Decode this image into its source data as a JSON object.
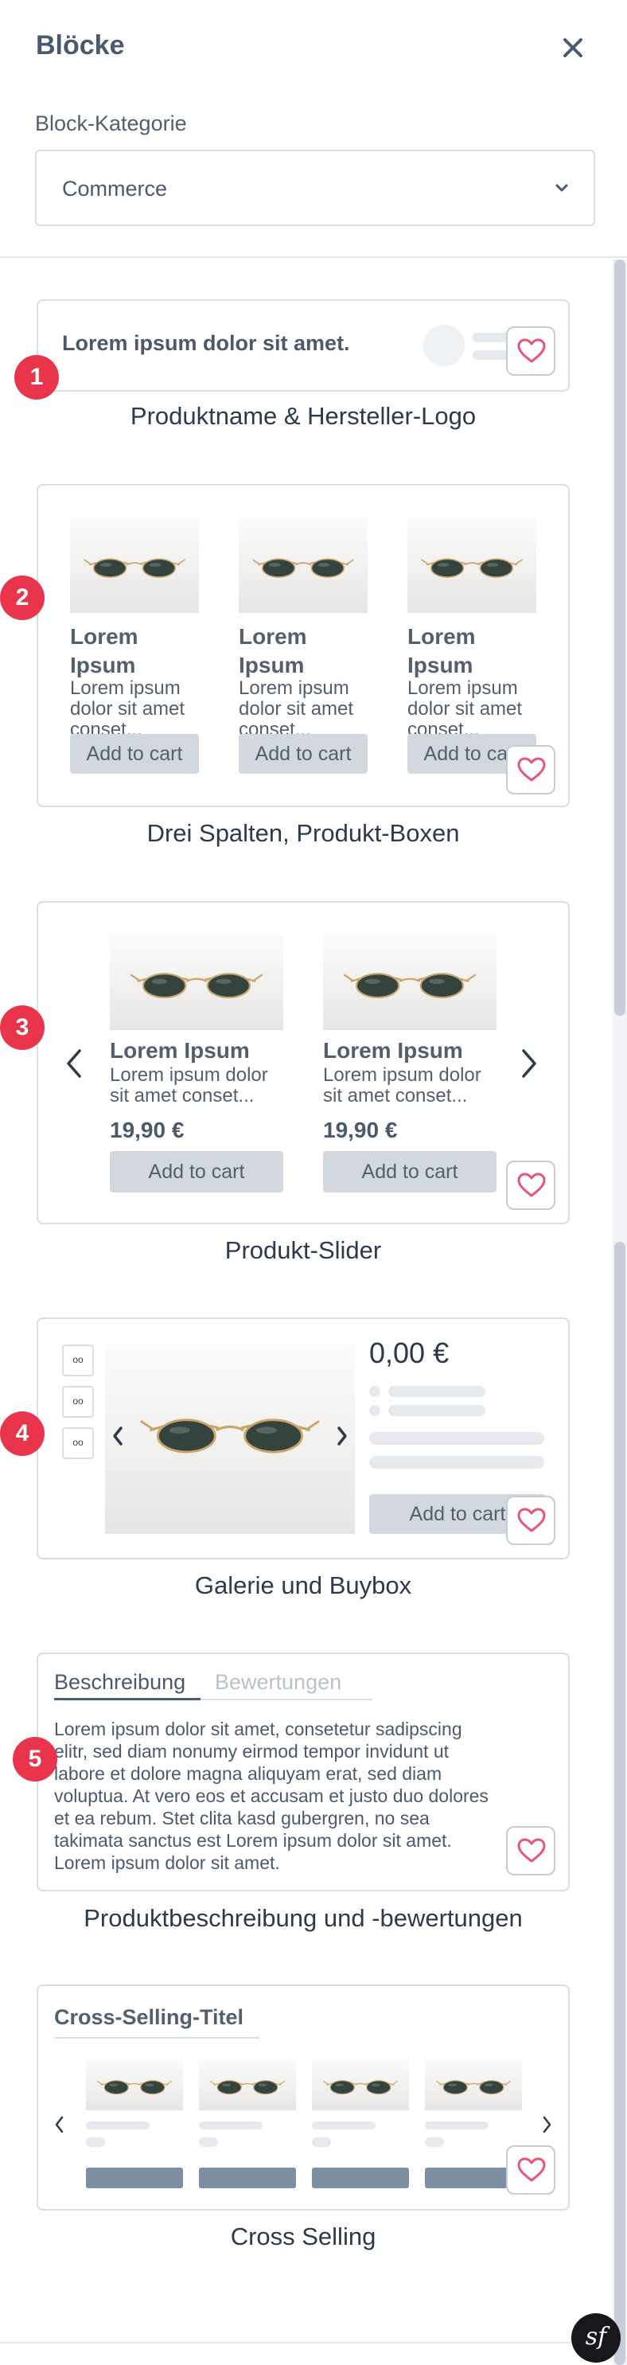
{
  "header": {
    "title": "Blöcke",
    "close_icon": "close-icon"
  },
  "category": {
    "label": "Block-Kategorie",
    "value": "Commerce"
  },
  "blocks": [
    {
      "number": "1",
      "caption": "Produktname & Hersteller-Logo",
      "preview_text": "Lorem ipsum dolor sit amet."
    },
    {
      "number": "2",
      "caption": "Drei Spalten, Produkt-Boxen",
      "product_title_line1": "Lorem",
      "product_title_line2": "Ipsum",
      "product_desc_line1": "Lorem ipsum",
      "product_desc_line2": "dolor sit amet",
      "product_desc_line3": "conset...",
      "button": "Add to cart"
    },
    {
      "number": "3",
      "caption": "Produkt-Slider",
      "product_title": "Lorem Ipsum",
      "product_desc_line1": "Lorem ipsum dolor",
      "product_desc_line2": "sit amet conset...",
      "price": "19,90 €",
      "button": "Add to cart"
    },
    {
      "number": "4",
      "caption": "Galerie und Buybox",
      "price": "0,00 €",
      "button": "Add to cart"
    },
    {
      "number": "5",
      "caption": "Produktbeschreibung und -bewertungen",
      "tab_active": "Beschreibung",
      "tab_inactive": "Bewertungen",
      "description_lines": [
        "Lorem ipsum dolor sit amet, consetetur sadipscing",
        "elitr, sed diam nonumy eirmod tempor invidunt ut",
        "labore et dolore magna aliquyam erat, sed diam",
        "voluptua. At vero eos et accusam et justo duo dolores",
        "et ea rebum. Stet clita kasd gubergren, no sea",
        "takimata sanctus est Lorem ipsum dolor sit amet.",
        "Lorem ipsum dolor sit amet."
      ]
    },
    {
      "number": "",
      "caption": "Cross Selling",
      "title": "Cross-Selling-Titel"
    }
  ],
  "colors": {
    "badge": "#e8354c",
    "heart": "#e8547a",
    "border": "#d6dde5",
    "text": "#2c3a4b",
    "button_bg": "#d2d8de",
    "cross_selling_button": "#7d8fa3"
  },
  "icons": {
    "favorite": "heart-icon",
    "dropdown": "chevron-down-icon",
    "prev": "chevron-left-icon",
    "next": "chevron-right-icon",
    "brand": "symfony-logo"
  }
}
